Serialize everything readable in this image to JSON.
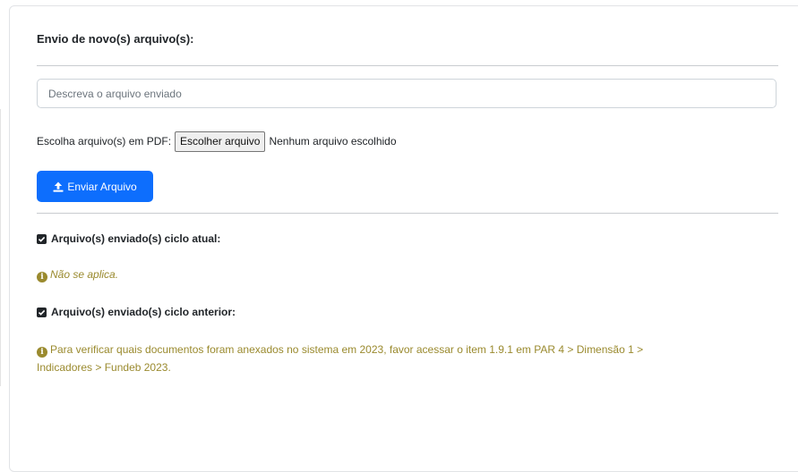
{
  "upload_section": {
    "title": "Envio de novo(s) arquivo(s):",
    "description_placeholder": "Descreva o arquivo enviado",
    "file_label": "Escolha arquivo(s) em PDF:",
    "file_button_label": "Escolher arquivo",
    "file_status": "Nenhum arquivo escolhido",
    "send_button_label": "Enviar Arquivo",
    "send_button_icon": "upload-icon",
    "accent_color": "#0d6efd"
  },
  "current_cycle": {
    "heading": "Arquivo(s) enviado(s) ciclo atual:",
    "heading_icon": "checkbox-checked-icon",
    "info_icon": "info-circle-icon",
    "info_text": "Não se aplica."
  },
  "previous_cycle": {
    "heading": "Arquivo(s) enviado(s) ciclo anterior:",
    "heading_icon": "checkbox-checked-icon",
    "info_icon": "info-circle-icon",
    "info_line1": "Para verificar quais documentos foram anexados no sistema em 2023, favor acessar o item 1.9.1 em PAR 4 > Dimensão 1 >",
    "info_line2": "Indicadores > Fundeb 2023.",
    "info_color": "#9a8a2e"
  }
}
